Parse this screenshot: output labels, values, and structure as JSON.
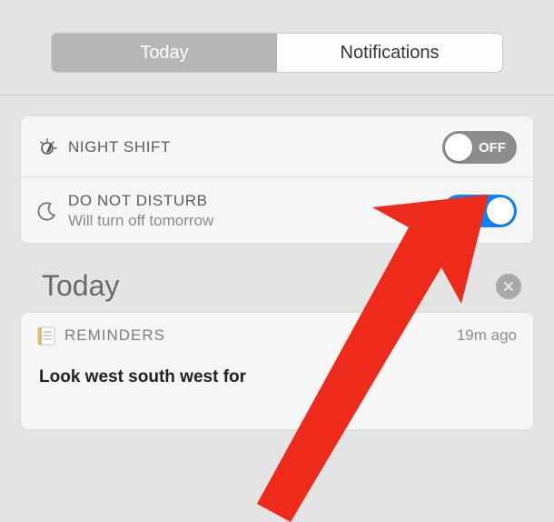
{
  "tabs": {
    "today": "Today",
    "notifications": "Notifications"
  },
  "nightShift": {
    "title": "NIGHT SHIFT",
    "state": "OFF"
  },
  "dnd": {
    "title": "DO NOT DISTURB",
    "subtitle": "Will turn off tomorrow",
    "state": "ON"
  },
  "section": {
    "heading": "Today"
  },
  "reminders": {
    "label": "REMINDERS",
    "time": "19m ago",
    "item": "Look west south west for"
  }
}
